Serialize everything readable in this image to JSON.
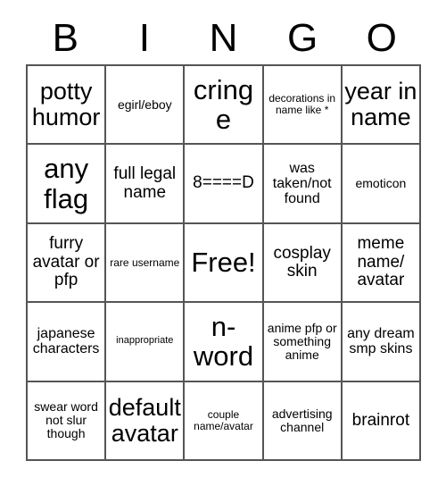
{
  "card": {
    "header_letters": [
      "B",
      "I",
      "N",
      "G",
      "O"
    ],
    "rows": [
      [
        {
          "text": "potty humor",
          "size": "xl"
        },
        {
          "text": "egirl/eboy",
          "size": "xs"
        },
        {
          "text": "cringe",
          "size": "xxl"
        },
        {
          "text": "decorations in name like *",
          "size": "xxs"
        },
        {
          "text": "year in name",
          "size": "xl"
        }
      ],
      [
        {
          "text": "any flag",
          "size": "xxl"
        },
        {
          "text": "full legal name",
          "size": "md"
        },
        {
          "text": "8====D",
          "size": "md"
        },
        {
          "text": "was taken/not found",
          "size": "sm"
        },
        {
          "text": "emoticon",
          "size": "xs"
        }
      ],
      [
        {
          "text": "furry avatar or pfp",
          "size": "md"
        },
        {
          "text": "rare username",
          "size": "xxs"
        },
        {
          "text": "Free!",
          "size": "xxl"
        },
        {
          "text": "cosplay skin",
          "size": "md"
        },
        {
          "text": "meme name/ avatar",
          "size": "md"
        }
      ],
      [
        {
          "text": "japanese characters",
          "size": "sm"
        },
        {
          "text": "inappropriate",
          "size": "tiny"
        },
        {
          "text": "n-word",
          "size": "xxl"
        },
        {
          "text": "anime pfp or something anime",
          "size": "xs"
        },
        {
          "text": "any dream smp skins",
          "size": "sm"
        }
      ],
      [
        {
          "text": "swear word not slur though",
          "size": "xs"
        },
        {
          "text": "default avatar",
          "size": "xl"
        },
        {
          "text": "couple name/avatar",
          "size": "xxs"
        },
        {
          "text": "advertising channel",
          "size": "xs"
        },
        {
          "text": "brainrot",
          "size": "md"
        }
      ]
    ]
  },
  "colors": {
    "background": "#ffffff",
    "border": "#555555",
    "text": "#000000"
  }
}
